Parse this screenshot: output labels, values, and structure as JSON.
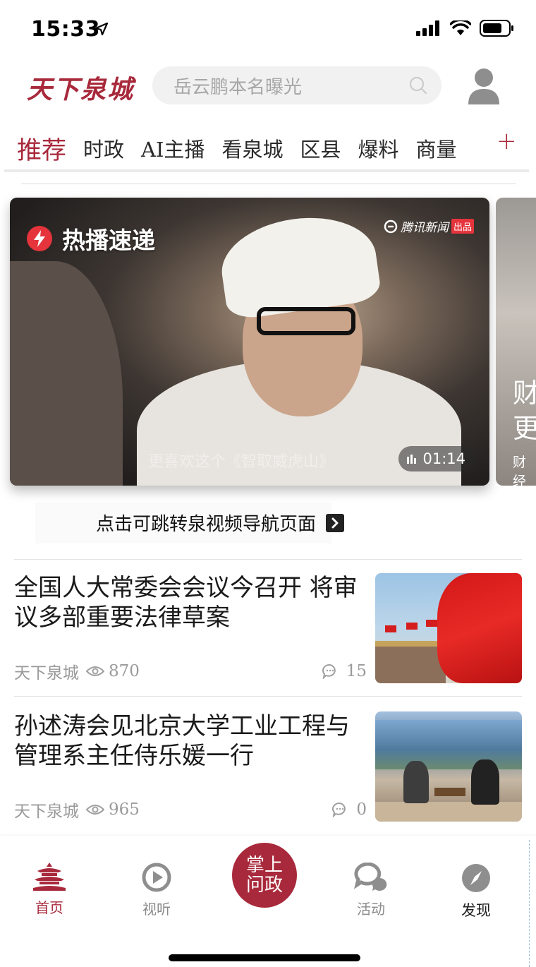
{
  "status_bar": {
    "time": "15:33"
  },
  "header": {
    "logo_text": "天下泉城",
    "search_placeholder": "岳云鹏本名曝光"
  },
  "channels": {
    "tabs": [
      {
        "label": "推荐",
        "active": true
      },
      {
        "label": "时政",
        "active": false
      },
      {
        "label": "AI主播",
        "active": false
      },
      {
        "label": "看泉城",
        "active": false
      },
      {
        "label": "区县",
        "active": false
      },
      {
        "label": "爆料",
        "active": false
      },
      {
        "label": "商量",
        "active": false
      }
    ],
    "add_label": "+"
  },
  "video_carousel": {
    "cards": [
      {
        "badge": "热播速递",
        "brand": "腾讯新闻",
        "brand_tag": "出品",
        "subtitle": "更喜欢这个《智取威虎山》",
        "duration": "01:14"
      },
      {
        "line1": "财",
        "line2": "更",
        "caption": "财经"
      }
    ],
    "nav_link": "点击可跳转泉视频导航页面"
  },
  "news": [
    {
      "title": "全国人大常委会会议今召开 将审议多部重要法律草案",
      "source": "天下泉城",
      "views": "870",
      "comments": "15"
    },
    {
      "title": "孙述涛会见北京大学工业工程与管理系主任侍乐媛一行",
      "source": "天下泉城",
      "views": "965",
      "comments": "0"
    }
  ],
  "tabbar": {
    "home": "首页",
    "media": "视听",
    "center_line1": "掌上",
    "center_line2": "问政",
    "activity": "活动",
    "discover": "发现"
  },
  "colors": {
    "brand_red": "#a8293b",
    "alert_red": "#e5343c"
  }
}
